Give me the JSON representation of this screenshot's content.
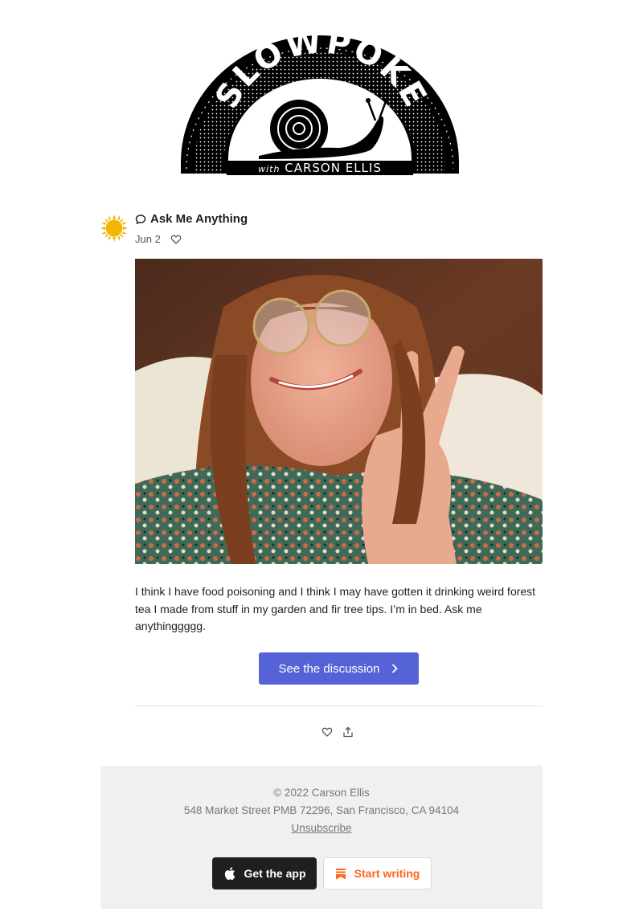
{
  "logo": {
    "name": "SLOWPOKE",
    "subtitle": "with CARSON ELLIS"
  },
  "post": {
    "title": "Ask Me Anything",
    "date": "Jun 2",
    "body": "I think I have food poisoning and I think I may have gotten it drinking weird forest tea I made from stuff in my garden and fir tree tips. I’m in bed. Ask me anythinggggg.",
    "cta_label": "See the discussion"
  },
  "footer": {
    "copyright": "© 2022 Carson Ellis",
    "address": "548 Market Street PMB 72296, San Francisco, CA 94104",
    "unsubscribe": "Unsubscribe",
    "get_app": "Get the app",
    "start_writing": "Start writing"
  },
  "colors": {
    "accent": "#5563d6",
    "brand_orange": "#ff6719",
    "sun": "#f2b705"
  },
  "icons": {
    "title": "speech-bubble-icon",
    "like": "heart-icon",
    "share": "share-icon",
    "cta": "chevron-right-icon",
    "app": "apple-icon",
    "write": "substack-bookmark-icon"
  }
}
